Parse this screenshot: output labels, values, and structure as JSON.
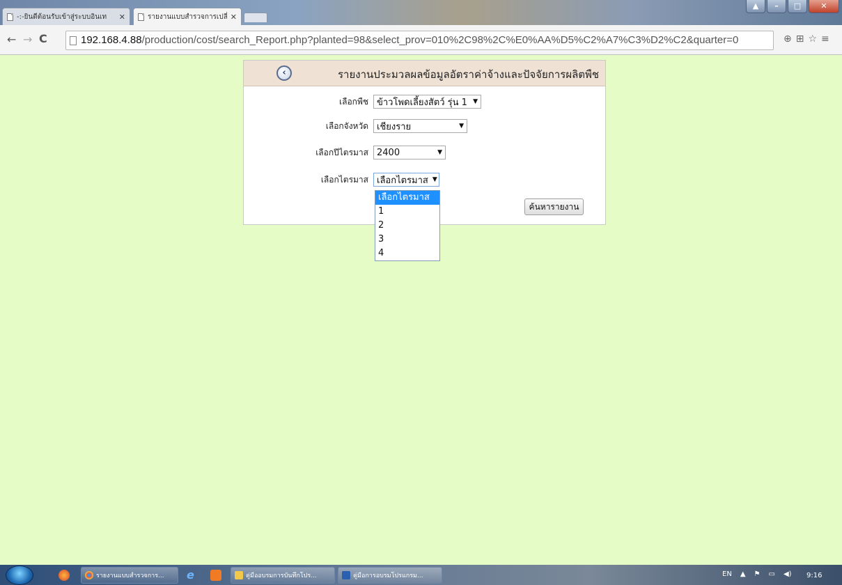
{
  "browser": {
    "tabs": [
      {
        "title": "-:-ยินดีต้อนรับเข้าสู่ระบบอินเท",
        "active": false
      },
      {
        "title": "รายงานแบบสำรวจการเปลี่ยนแ",
        "active": true
      }
    ],
    "url_host": "192.168.4.88",
    "url_rest": "/production/cost/search_Report.php?planted=98&select_prov=010%2C98%2C%E0%AA%D5%C2%A7%C3%D2%C2&quarter=0"
  },
  "panel": {
    "title": "รายงานประมวลผลข้อมูลอัตราค่าจ้างและปัจจัยการผลิตพืช"
  },
  "form": {
    "plant": {
      "label": "เลือกพืช",
      "value": "ข้าวโพดเลี้ยงสัตว์ รุ่น 1"
    },
    "province": {
      "label": "เลือกจังหวัด",
      "value": "เชียงราย"
    },
    "year": {
      "label": "เลือกปีไตรมาส",
      "value": "2400"
    },
    "quarter": {
      "label": "เลือกไตรมาส",
      "value": "เลือกไตรมาส"
    },
    "search_button": "ค้นหารายงาน"
  },
  "quarter_options": [
    "เลือกไตรมาส",
    "1",
    "2",
    "3",
    "4"
  ],
  "taskbar": {
    "items": [
      {
        "label": "รายงานแบบสำรวจการ..."
      },
      {
        "label": "คู่มืออบรมการบันทึกโปร..."
      },
      {
        "label": "คู่มือการอบรมโปรแกรม..."
      }
    ],
    "lang": "EN",
    "clock": "9:16"
  },
  "colors": {
    "page_background": "#e6fcc6",
    "panel_header": "#efe1d4",
    "dropdown_highlight": "#1e90ff"
  }
}
